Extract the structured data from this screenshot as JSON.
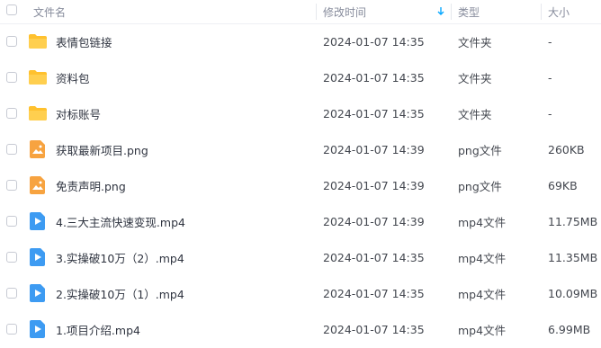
{
  "header": {
    "name": "文件名",
    "modified": "修改时间",
    "sort_icon": "arrow-down-icon",
    "type": "类型",
    "size": "大小"
  },
  "files": [
    {
      "name": "表情包链接",
      "modified": "2024-01-07 14:35",
      "type": "文件夹",
      "size": "-",
      "icon": "folder-icon"
    },
    {
      "name": "资料包",
      "modified": "2024-01-07 14:35",
      "type": "文件夹",
      "size": "-",
      "icon": "folder-icon"
    },
    {
      "name": "对标账号",
      "modified": "2024-01-07 14:35",
      "type": "文件夹",
      "size": "-",
      "icon": "folder-icon"
    },
    {
      "name": "获取最新项目.png",
      "modified": "2024-01-07 14:39",
      "type": "png文件",
      "size": "260KB",
      "icon": "image-file-icon"
    },
    {
      "name": "免责声明.png",
      "modified": "2024-01-07 14:39",
      "type": "png文件",
      "size": "69KB",
      "icon": "image-file-icon"
    },
    {
      "name": "4.三大主流快速变现.mp4",
      "modified": "2024-01-07 14:39",
      "type": "mp4文件",
      "size": "11.75MB",
      "icon": "video-file-icon"
    },
    {
      "name": "3.实操破10万（2）.mp4",
      "modified": "2024-01-07 14:35",
      "type": "mp4文件",
      "size": "11.35MB",
      "icon": "video-file-icon"
    },
    {
      "name": "2.实操破10万（1）.mp4",
      "modified": "2024-01-07 14:35",
      "type": "mp4文件",
      "size": "10.09MB",
      "icon": "video-file-icon"
    },
    {
      "name": "1.项目介绍.mp4",
      "modified": "2024-01-07 14:35",
      "type": "mp4文件",
      "size": "6.99MB",
      "icon": "video-file-icon"
    }
  ],
  "colors": {
    "folder": "#ffc12e",
    "image_file": "#f7a340",
    "video_file": "#3d9bf2",
    "sort_accent": "#06a7ff"
  }
}
